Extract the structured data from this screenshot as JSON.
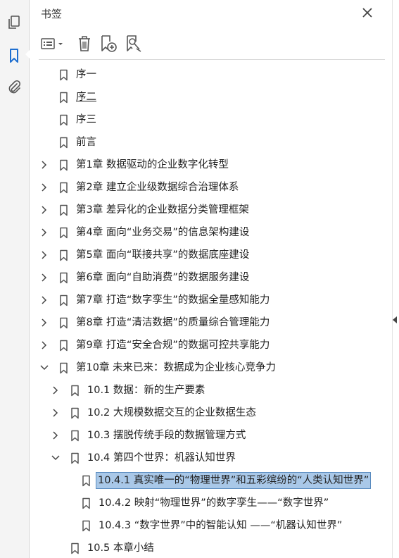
{
  "panel": {
    "title": "书签"
  },
  "icons": {
    "rail": [
      "pages-icon",
      "bookmark-icon",
      "attachment-icon"
    ],
    "toolbar": [
      "options-menu-icon",
      "delete-icon",
      "new-bookmark-icon",
      "bookmark-search-icon"
    ],
    "accent": "#1f6fd0",
    "selection_bg": "#a9c8e8"
  },
  "bookmarks": [
    {
      "label": "序一",
      "level": 0,
      "expander": "none"
    },
    {
      "label": "序二",
      "level": 0,
      "expander": "none",
      "underline": true
    },
    {
      "label": "序三",
      "level": 0,
      "expander": "none"
    },
    {
      "label": "前言",
      "level": 0,
      "expander": "none"
    },
    {
      "label": "第1章 数据驱动的企业数字化转型",
      "level": 0,
      "expander": "collapsed"
    },
    {
      "label": "第2章 建立企业级数据综合治理体系",
      "level": 0,
      "expander": "collapsed"
    },
    {
      "label": "第3章 差异化的企业数据分类管理框架",
      "level": 0,
      "expander": "collapsed"
    },
    {
      "label": "第4章 面向“业务交易”的信息架构建设",
      "level": 0,
      "expander": "collapsed"
    },
    {
      "label": "第5章 面向“联接共享”的数据底座建设",
      "level": 0,
      "expander": "collapsed"
    },
    {
      "label": "第6章 面向“自助消费”的数据服务建设",
      "level": 0,
      "expander": "collapsed"
    },
    {
      "label": "第7章 打造“数字孪生”的数据全量感知能力",
      "level": 0,
      "expander": "collapsed"
    },
    {
      "label": "第8章 打造“清洁数据”的质量综合管理能力",
      "level": 0,
      "expander": "collapsed"
    },
    {
      "label": "第9章 打造“安全合规”的数据可控共享能力",
      "level": 0,
      "expander": "collapsed"
    },
    {
      "label": "第10章 未来已来：数据成为企业核心竞争力",
      "level": 0,
      "expander": "expanded"
    },
    {
      "label": "10.1 数据：新的生产要素",
      "level": 1,
      "expander": "collapsed"
    },
    {
      "label": "10.2 大规模数据交互的企业数据生态",
      "level": 1,
      "expander": "collapsed"
    },
    {
      "label": "10.3 摆脱传统手段的数据管理方式",
      "level": 1,
      "expander": "collapsed"
    },
    {
      "label": "10.4 第四个世界：机器认知世界",
      "level": 1,
      "expander": "expanded"
    },
    {
      "label": "10.4.1 真实唯一的“物理世界”和五彩缤纷的“人类认知世界”",
      "level": 2,
      "expander": "none",
      "selected": true
    },
    {
      "label": "10.4.2 映射“物理世界”的数字孪生——“数字世界”",
      "level": 2,
      "expander": "none"
    },
    {
      "label": "10.4.3 “数字世界”中的智能认知 ——“机器认知世界”",
      "level": 2,
      "expander": "none"
    },
    {
      "label": "10.5 本章小结",
      "level": 1,
      "expander": "none"
    }
  ]
}
